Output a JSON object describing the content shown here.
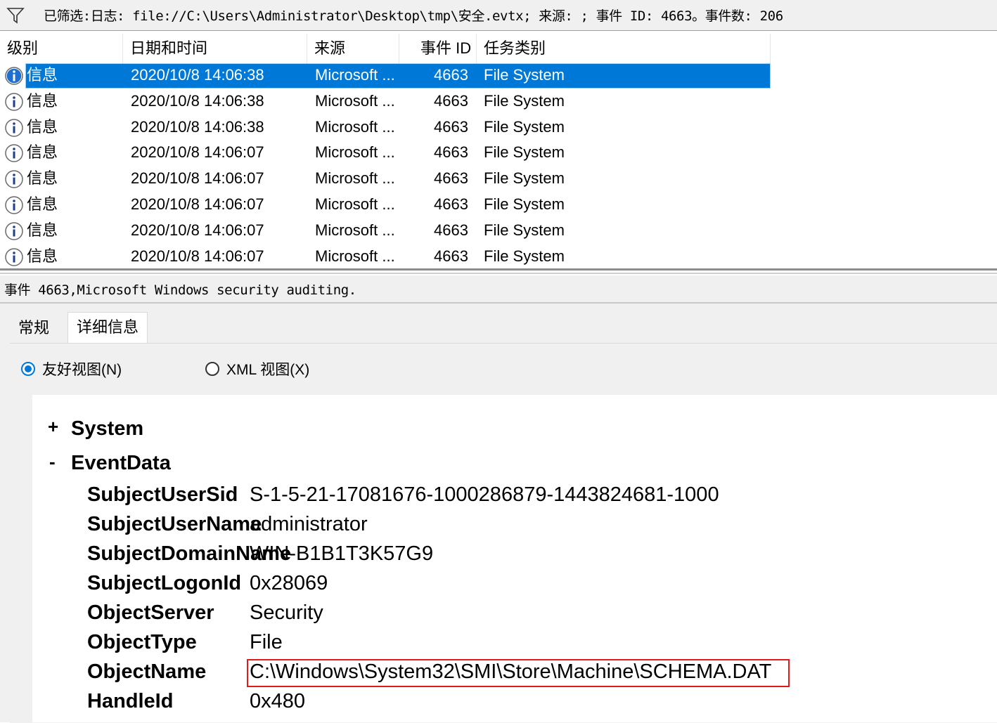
{
  "filter_bar": {
    "icon": "filter-icon",
    "text": "已筛选:日志: file://C:\\Users\\Administrator\\Desktop\\tmp\\安全.evtx; 来源: ; 事件 ID: 4663。事件数: 206"
  },
  "grid": {
    "columns": [
      "级别",
      "日期和时间",
      "来源",
      "事件 ID",
      "任务类别"
    ],
    "rows": [
      {
        "level": "信息",
        "datetime": "2020/10/8 14:06:38",
        "source": "Microsoft ...",
        "event_id": "4663",
        "task": "File System",
        "selected": true
      },
      {
        "level": "信息",
        "datetime": "2020/10/8 14:06:38",
        "source": "Microsoft ...",
        "event_id": "4663",
        "task": "File System"
      },
      {
        "level": "信息",
        "datetime": "2020/10/8 14:06:38",
        "source": "Microsoft ...",
        "event_id": "4663",
        "task": "File System"
      },
      {
        "level": "信息",
        "datetime": "2020/10/8 14:06:07",
        "source": "Microsoft ...",
        "event_id": "4663",
        "task": "File System"
      },
      {
        "level": "信息",
        "datetime": "2020/10/8 14:06:07",
        "source": "Microsoft ...",
        "event_id": "4663",
        "task": "File System"
      },
      {
        "level": "信息",
        "datetime": "2020/10/8 14:06:07",
        "source": "Microsoft ...",
        "event_id": "4663",
        "task": "File System"
      },
      {
        "level": "信息",
        "datetime": "2020/10/8 14:06:07",
        "source": "Microsoft ...",
        "event_id": "4663",
        "task": "File System"
      },
      {
        "level": "信息",
        "datetime": "2020/10/8 14:06:07",
        "source": "Microsoft ...",
        "event_id": "4663",
        "task": "File System"
      }
    ]
  },
  "detail": {
    "title": "事件 4663,Microsoft Windows security auditing.",
    "tabs": [
      "常规",
      "详细信息"
    ],
    "active_tab": "详细信息",
    "view_options": [
      {
        "label": "友好视图(N)",
        "checked": true
      },
      {
        "label": "XML 视图(X)",
        "checked": false
      }
    ],
    "tree": {
      "system": {
        "toggle": "+",
        "label": "System"
      },
      "event_data": {
        "toggle": "-",
        "label": "EventData"
      },
      "fields": [
        {
          "key": "SubjectUserSid",
          "value": "S-1-5-21-17081676-1000286879-1443824681-1000"
        },
        {
          "key": "SubjectUserName",
          "value": "administrator"
        },
        {
          "key": "SubjectDomainName",
          "value": "WIN-B1B1T3K57G9"
        },
        {
          "key": "SubjectLogonId",
          "value": "0x28069"
        },
        {
          "key": "ObjectServer",
          "value": "Security"
        },
        {
          "key": "ObjectType",
          "value": "File"
        },
        {
          "key": "ObjectName",
          "value": "C:\\Windows\\System32\\SMI\\Store\\Machine\\SCHEMA.DAT",
          "highlighted": true
        },
        {
          "key": "HandleId",
          "value": "0x480"
        }
      ]
    },
    "highlight_color": "#e01b1b"
  },
  "colors": {
    "selection": "#0078d7",
    "info_icon_blue": "#1e6fd0",
    "panel_bg": "#f0f0f0"
  }
}
